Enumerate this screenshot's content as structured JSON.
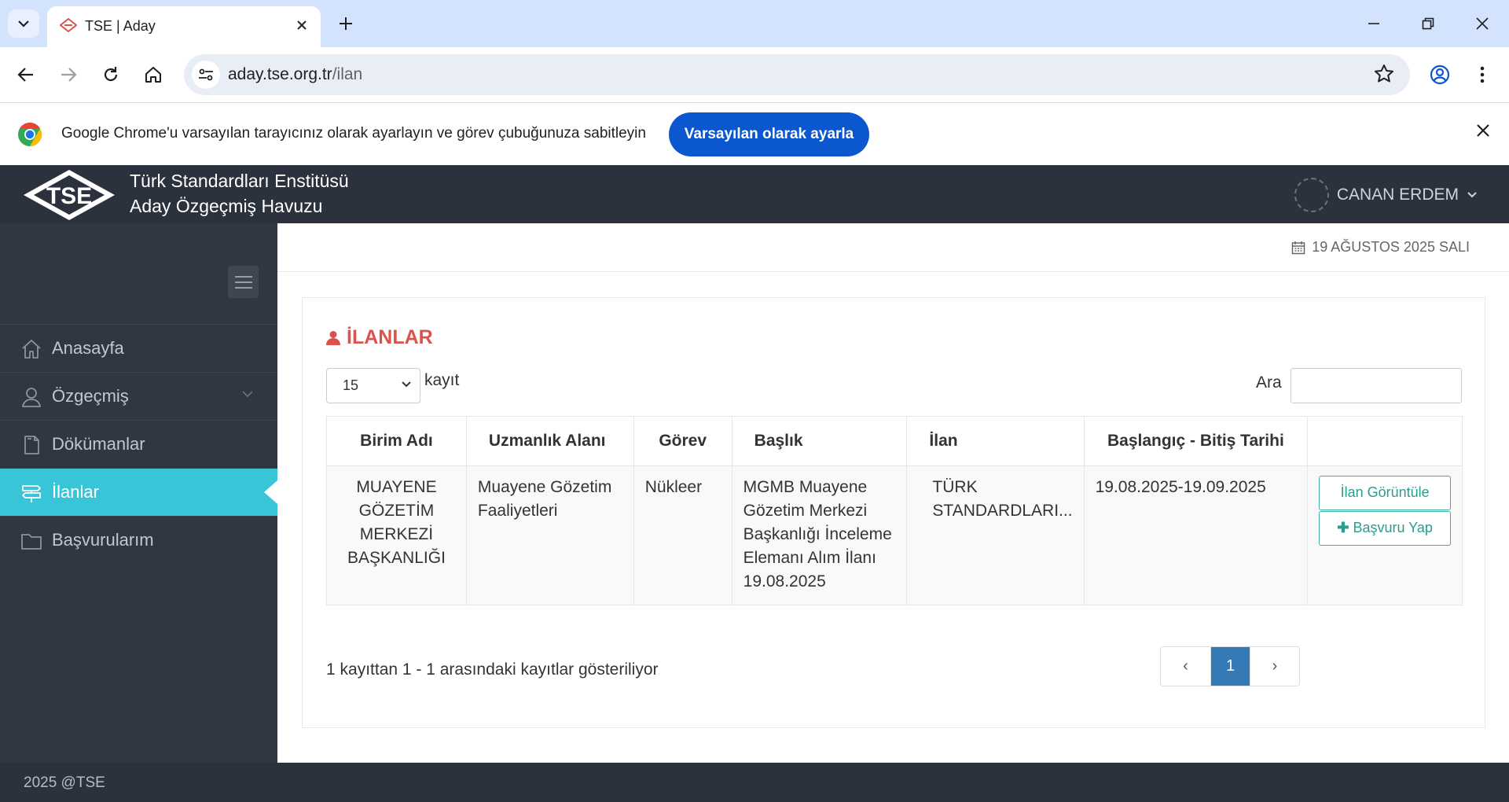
{
  "browser": {
    "tab_title": "TSE | Aday",
    "url_host": "aday.tse.org.tr",
    "url_path": "/ilan",
    "infobar_text": "Google Chrome'u varsayılan tarayıcınız olarak ayarlayın ve görev çubuğunuza sabitleyin",
    "infobar_button": "Varsayılan olarak ayarla"
  },
  "header": {
    "logo_text": "TSE",
    "brand_line1": "Türk Standardları Enstitüsü",
    "brand_line2": "Aday Özgeçmiş Havuzu",
    "user_name": "CANAN ERDEM"
  },
  "sidebar": {
    "items": [
      {
        "label": "Anasayfa",
        "icon": "home-icon"
      },
      {
        "label": "Özgeçmiş",
        "icon": "user-icon"
      },
      {
        "label": "Dökümanlar",
        "icon": "document-icon"
      },
      {
        "label": "İlanlar",
        "icon": "signpost-icon",
        "active": true
      },
      {
        "label": "Başvurularım",
        "icon": "folder-icon"
      }
    ]
  },
  "date_text": "19 AĞUSTOS 2025 SALI",
  "panel": {
    "title": "İLANLAR",
    "length_value": "15",
    "length_label": "kayıt",
    "search_label": "Ara",
    "search_value": ""
  },
  "table": {
    "headers": [
      "Birim Adı",
      "Uzmanlık Alanı",
      "Görev",
      "Başlık",
      "İlan",
      "Başlangıç - Bitiş Tarihi",
      ""
    ],
    "rows": [
      {
        "birim": "MUAYENE GÖZETİM MERKEZİ BAŞKANLIĞI",
        "uzmanlik": "Muayene Gözetim Faaliyetleri",
        "gorev": "Nükleer",
        "baslik": "MGMB Muayene Gözetim Merkezi Başkanlığı İnceleme Elemanı Alım İlanı 19.08.2025",
        "ilan": "TÜRK STANDARDLARI...",
        "tarih": "19.08.2025-19.09.2025",
        "view_button": "İlan Görüntüle",
        "apply_button": "Başvuru Yap"
      }
    ]
  },
  "info_text": "1 kayıttan 1 - 1 arasındaki kayıtlar gösteriliyor",
  "pagination": {
    "current": "1",
    "prev": "‹",
    "next": "›"
  },
  "footer_text": "2025 @TSE",
  "colors": {
    "accent": "#39c5d8",
    "title_red": "#d9534f",
    "sidebar_bg": "#2f3742",
    "topbar_bg": "#2b323d",
    "page_active": "#337ab7",
    "chrome_button": "#0b57d0"
  }
}
